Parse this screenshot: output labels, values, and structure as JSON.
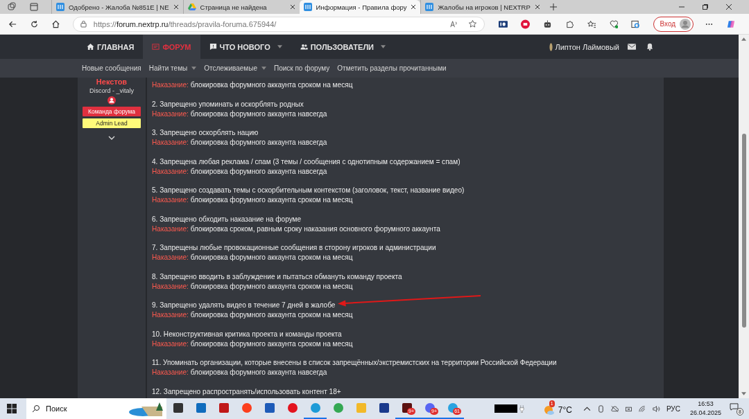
{
  "browser": {
    "tabs": [
      {
        "title": "Одобрено - Жалоба №851E | NE",
        "selected": false
      },
      {
        "title": "Страница не найдена",
        "selected": false
      },
      {
        "title": "Информация - Правила фору",
        "selected": true
      },
      {
        "title": "Жалобы на игроков | NEXTRP",
        "selected": false
      }
    ],
    "address": {
      "scheme": "https://",
      "host": "forum.nextrp.ru",
      "path": "/threads/pravila-foruma.675944/"
    },
    "sign_in": "Вход"
  },
  "forum": {
    "nav": [
      {
        "label": "ГЛАВНАЯ",
        "dropdown": false,
        "selected": false
      },
      {
        "label": "ФОРУМ",
        "dropdown": false,
        "selected": true
      },
      {
        "label": "ЧТО НОВОГО",
        "dropdown": true,
        "selected": false
      },
      {
        "label": "ПОЛЬЗОВАТЕЛИ",
        "dropdown": true,
        "selected": false
      }
    ],
    "user": "Липтон Лаймовый",
    "subnav": [
      {
        "label": "Новые сообщения",
        "dropdown": false
      },
      {
        "label": "Найти темы",
        "dropdown": true
      },
      {
        "label": "Отслеживаемые",
        "dropdown": true
      },
      {
        "label": "Поиск по форуму",
        "dropdown": false
      },
      {
        "label": "Отметить разделы прочитанными",
        "dropdown": false
      }
    ],
    "author": {
      "name": "Некстов",
      "discord": "Discord - _vitaly",
      "banners": [
        {
          "label": "Команда форума",
          "color": "#e0303f"
        },
        {
          "label": "Admin Lead",
          "color": "#fffa7a"
        }
      ]
    },
    "rules": [
      {
        "penalty_label": "Наказание:",
        "penalty": "блокировка форумного аккаунта сроком на месяц",
        "arrow": false
      },
      {
        "text": "2. Запрещено упоминать и оскорблять родных",
        "penalty_label": "Наказание:",
        "penalty": "блокировка форумного аккаунта навсегда",
        "arrow": false
      },
      {
        "text": "3. Запрещено оскорблять нацию",
        "penalty_label": "Наказание:",
        "penalty": "блокировка форумного аккаунта навсегда",
        "arrow": false
      },
      {
        "text": "4. Запрещена любая реклама / спам (3 темы / сообщения с однотипным содержанием = спам)",
        "penalty_label": "Наказание:",
        "penalty": "блокировка форумного аккаунта навсегда",
        "arrow": false
      },
      {
        "text": "5. Запрещено создавать темы с оскорбительным контекстом (заголовок, текст, название видео)",
        "penalty_label": "Наказание:",
        "penalty": "блокировка форумного аккаунта сроком на месяц",
        "arrow": false
      },
      {
        "text": "6. Запрещено обходить наказание на форуме",
        "penalty_label": "Наказание:",
        "penalty": "блокировка сроком, равным сроку наказания основного форумного аккаунта",
        "arrow": false
      },
      {
        "text": "7. Запрещены любые провокационные сообщения в сторону игроков и администрации",
        "penalty_label": "Наказание:",
        "penalty": "блокировка форумного аккаунта сроком на месяц",
        "arrow": false
      },
      {
        "text": "8. Запрещено вводить в заблуждение и пытаться обмануть команду проекта",
        "penalty_label": "Наказание:",
        "penalty": "блокировка форумного аккаунта сроком на месяц",
        "arrow": false
      },
      {
        "text": "9. Запрещено удалять видео в течение 7 дней в жалобе",
        "penalty_label": "Наказание:",
        "penalty": "блокировка форумного аккаунта сроком на месяц",
        "arrow": true
      },
      {
        "text": "10. Неконструктивная критика проекта и команды проекта",
        "penalty_label": "Наказание:",
        "penalty": "блокировка форумного аккаунта сроком на месяц",
        "arrow": false
      },
      {
        "text": "11. Упоминать организации, которые внесены в список запрещённых/экстремистских на территории Российской Федерации",
        "penalty_label": "Наказание:",
        "penalty": "блокировка форумного аккаунта навсегда",
        "arrow": false
      },
      {
        "text": "12. Запрещено распространять/использовать контент 18+",
        "arrow": false
      }
    ]
  },
  "taskbar": {
    "search": "Поиск",
    "apps": [
      {
        "kind": "taskview",
        "active": false
      },
      {
        "kind": "outlook",
        "active": false
      },
      {
        "kind": "shield",
        "active": false
      },
      {
        "kind": "yandex",
        "active": false
      },
      {
        "kind": "store",
        "active": false
      },
      {
        "kind": "opera",
        "active": false
      },
      {
        "kind": "edge",
        "active": true
      },
      {
        "kind": "chrome",
        "active": false
      },
      {
        "kind": "folder",
        "active": false
      },
      {
        "kind": "letter",
        "active": false
      },
      {
        "kind": "game",
        "badge": "9+",
        "active": true
      },
      {
        "kind": "discord",
        "badge": "9+",
        "active": true
      },
      {
        "kind": "telegram",
        "badge": "61",
        "active": true
      }
    ],
    "weather_badge": "1",
    "temperature": "7°C",
    "language": "РУС",
    "time": "16:53",
    "date": "26.04.2025",
    "notifications": "8"
  }
}
